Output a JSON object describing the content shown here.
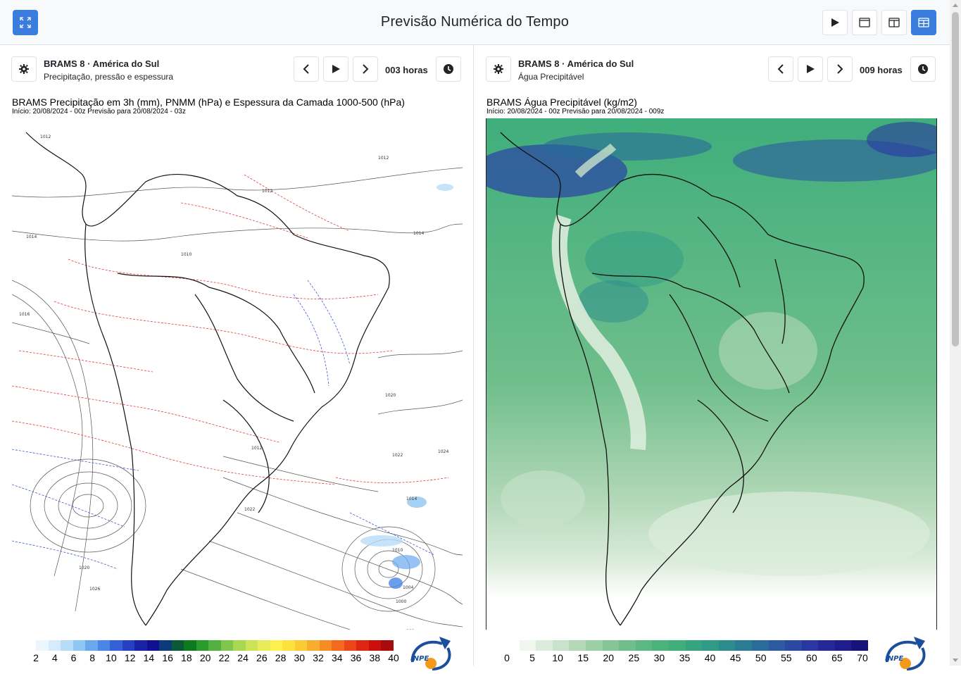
{
  "header": {
    "title": "Previsão Numérica do Tempo"
  },
  "panels": [
    {
      "model": "BRAMS 8 · América do Sul",
      "description": "Precipitação, pressão e espessura",
      "hours": "003 horas",
      "map_title": "BRAMS Precipitação em 3h (mm), PNMM (hPa) e Espessura da Camada 1000-500 (hPa)",
      "map_subtitle": "Início: 20/08/2024 - 00z  Previsão para 20/08/2024 - 03z",
      "colorbar_ticks": [
        "2",
        "4",
        "6",
        "8",
        "10",
        "12",
        "14",
        "16",
        "18",
        "20",
        "22",
        "24",
        "26",
        "28",
        "30",
        "32",
        "34",
        "36",
        "38",
        "40"
      ],
      "colorbar_colors": [
        "#eef6fd",
        "#d6ebfb",
        "#b7dcf8",
        "#8fc6f3",
        "#6aa9ee",
        "#4a86e6",
        "#3561d8",
        "#2540c3",
        "#1a23a8",
        "#101090",
        "#0d3a7a",
        "#0b5a37",
        "#0c7a1d",
        "#2a9a2a",
        "#52b040",
        "#7ec74c",
        "#a6d850",
        "#cde356",
        "#e8ec58",
        "#fbf04e",
        "#fde23f",
        "#fcca35",
        "#f9ad2c",
        "#f68d24",
        "#f16a1e",
        "#ea4619",
        "#df2612",
        "#c9100d",
        "#a80b0b"
      ],
      "logo_text": "INPE"
    },
    {
      "model": "BRAMS 8 · América do Sul",
      "description": "Água Precipitável",
      "hours": "009 horas",
      "map_title": "BRAMS Água Precipitável (kg/m2)",
      "map_subtitle": "Início: 20/08/2024 - 00z  Previsão para 20/08/2024 - 009z",
      "colorbar_ticks": [
        "0",
        "5",
        "10",
        "15",
        "20",
        "25",
        "30",
        "35",
        "40",
        "45",
        "50",
        "55",
        "60",
        "65",
        "70"
      ],
      "colorbar_colors": [
        "#ffffff",
        "#eef6ee",
        "#dcecdc",
        "#c8e2cb",
        "#b3d8b8",
        "#9ccfa6",
        "#85c597",
        "#6fbe8b",
        "#5cb882",
        "#4cb27c",
        "#3fae7b",
        "#36a57f",
        "#2f9a86",
        "#2c8b8d",
        "#2a7c94",
        "#2a6b9a",
        "#2b5aa0",
        "#2b48a3",
        "#2a37a2",
        "#26289a",
        "#1f1d8c",
        "#17137a"
      ],
      "logo_text": "INPE"
    }
  ]
}
